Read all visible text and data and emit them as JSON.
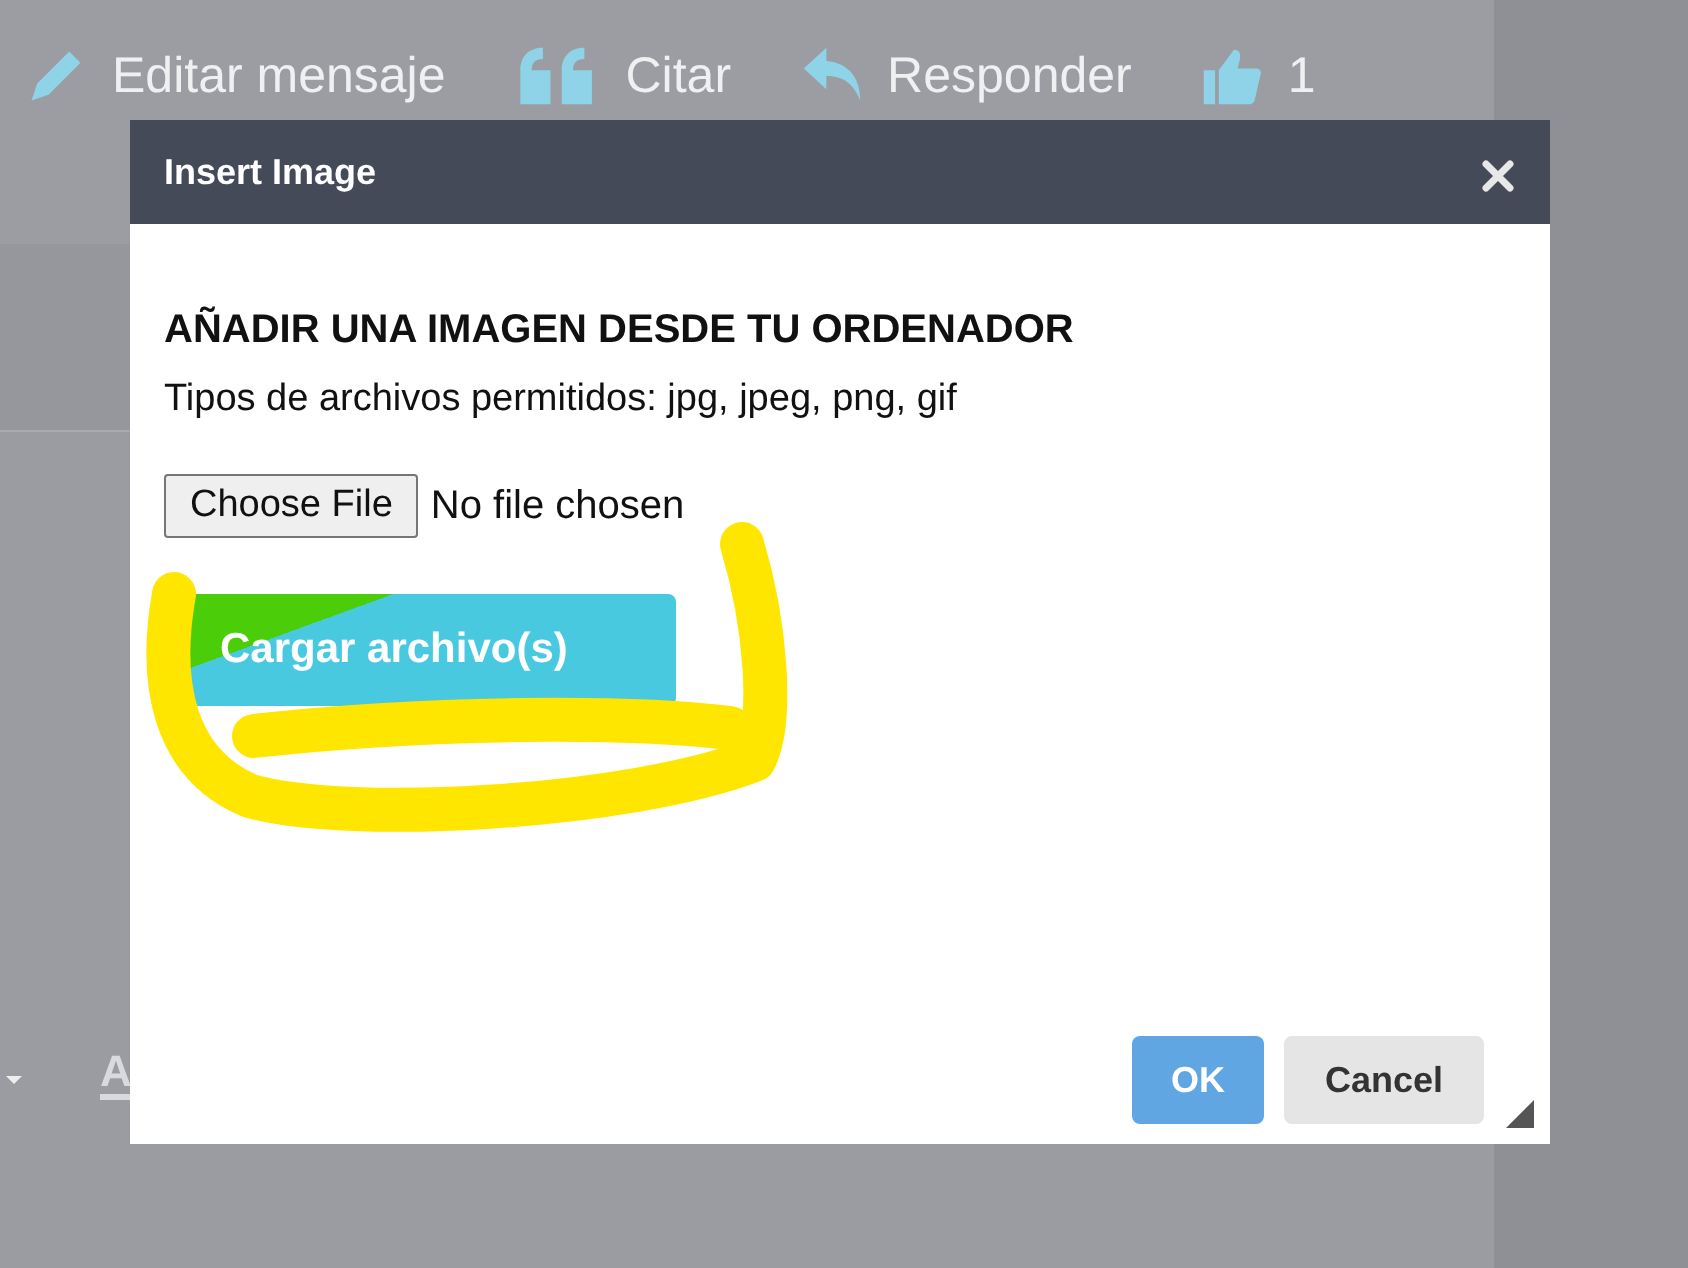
{
  "background": {
    "toolbar": [
      {
        "kind": "edit",
        "label": "Editar mensaje"
      },
      {
        "kind": "quote",
        "label": "Citar"
      },
      {
        "kind": "reply",
        "label": "Responder"
      },
      {
        "kind": "like",
        "label": "1"
      }
    ],
    "editor_label": "A"
  },
  "dialog": {
    "title": "Insert Image",
    "heading": "AÑADIR UNA IMAGEN DESDE TU ORDENADOR",
    "allowed": "Tipos de archivos permitidos: jpg, jpeg, png, gif",
    "file_button": "Choose File",
    "file_status": "No file chosen",
    "upload_button": "Cargar archivo(s)",
    "buttons": [
      {
        "kind": "primary",
        "label": "OK"
      },
      {
        "kind": "secondary",
        "label": "Cancel"
      }
    ]
  }
}
